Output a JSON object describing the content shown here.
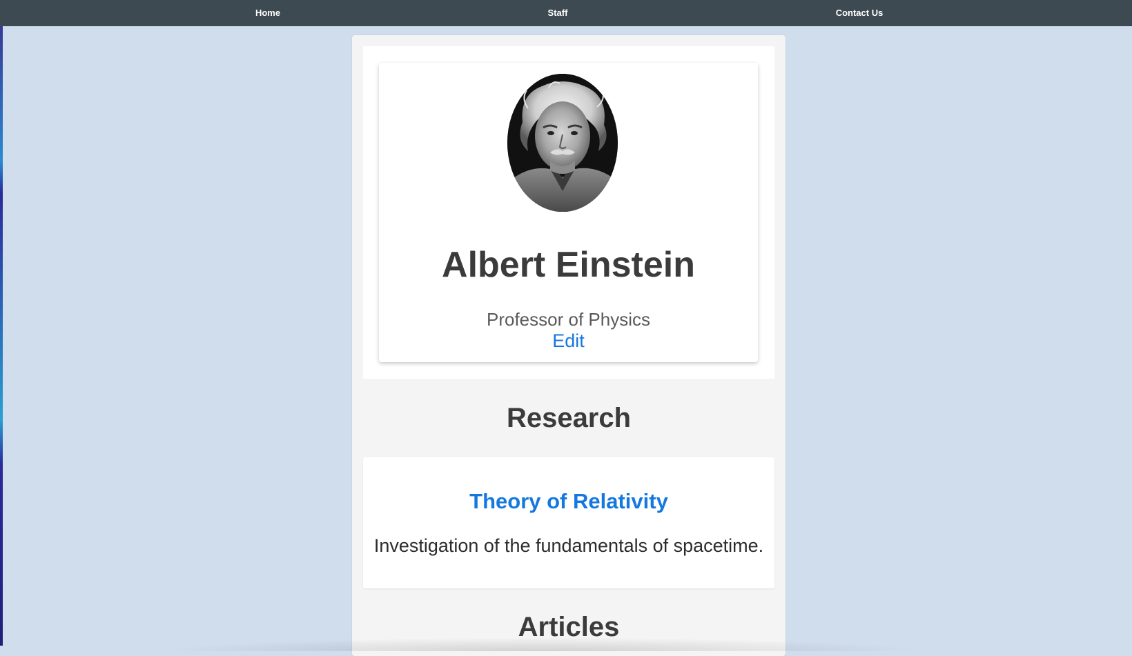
{
  "nav": {
    "home": "Home",
    "staff": "Staff",
    "contact": "Contact Us"
  },
  "profile": {
    "photo_icon": "portrait-photo",
    "name": "Albert Einstein",
    "title": "Professor of Physics",
    "edit_label": "Edit"
  },
  "research": {
    "heading": "Research",
    "items": [
      {
        "title": "Theory of Relativity",
        "description": "Investigation of the fundamentals of spacetime."
      }
    ]
  },
  "articles": {
    "heading": "Articles"
  },
  "colors": {
    "navbar": "#3e4a52",
    "page_background": "#d0dded",
    "link": "#1478e0",
    "heading_text": "#3b3b3b"
  }
}
